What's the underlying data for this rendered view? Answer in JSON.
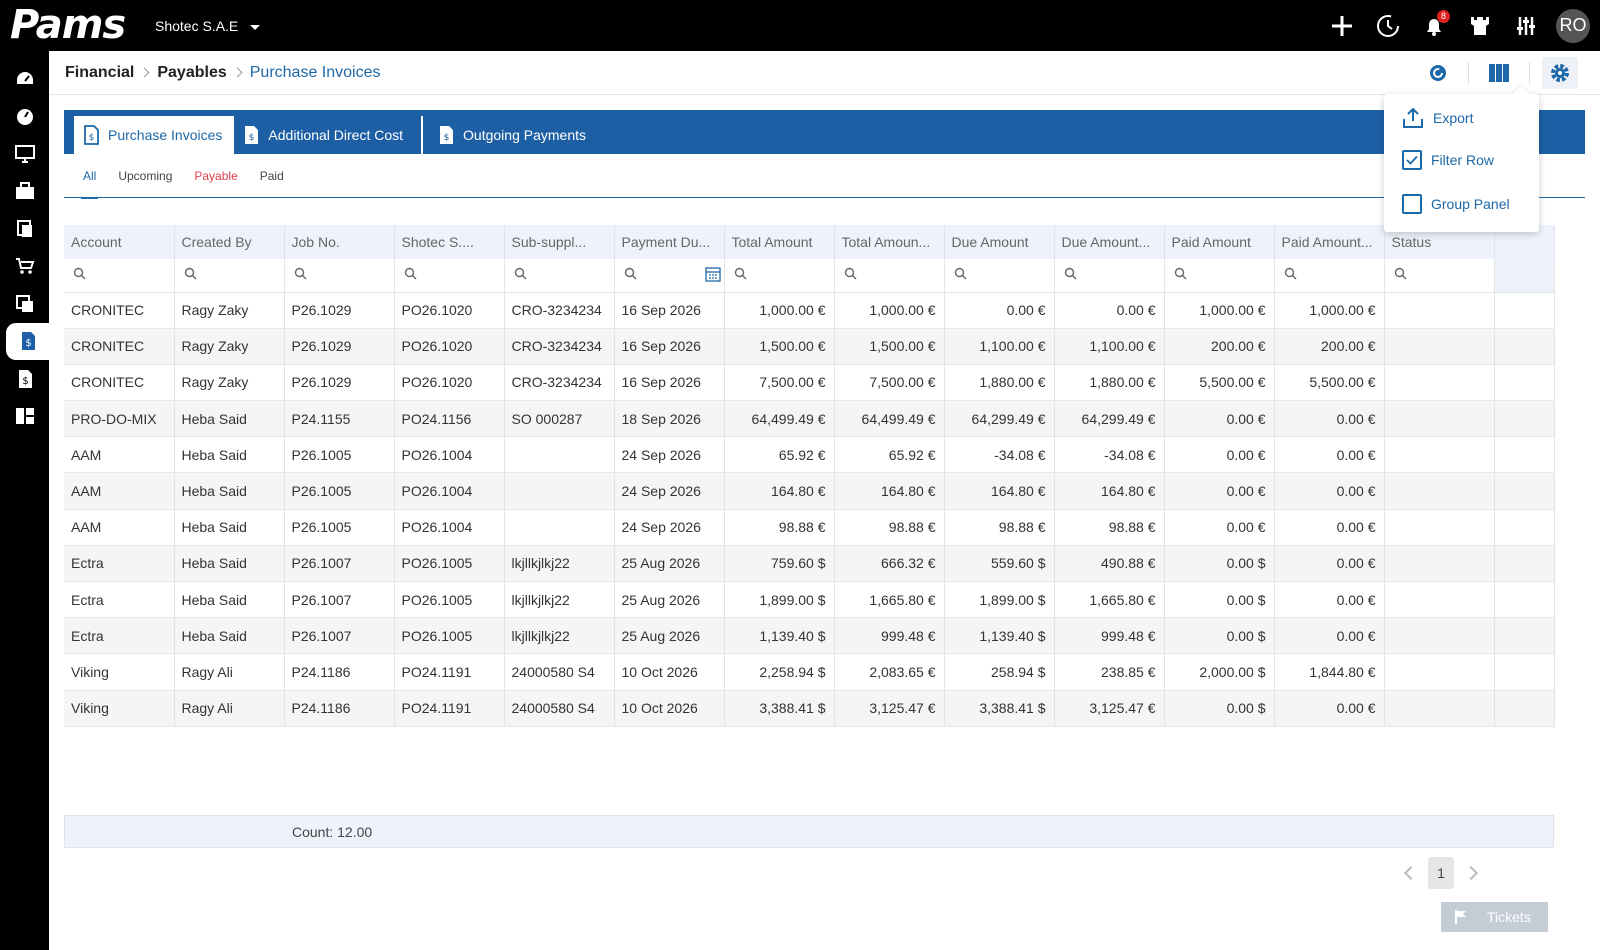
{
  "app": {
    "logo_text": "Pams",
    "company": "Shotec S.A.E",
    "notification_count": "8",
    "avatar_initials": "RO"
  },
  "breadcrumb": {
    "items": [
      "Financial",
      "Payables"
    ],
    "current": "Purchase Invoices"
  },
  "tabs": [
    {
      "label": "Purchase Invoices",
      "icon": "invoice-icon"
    },
    {
      "label": "Additional Direct Cost",
      "icon": "invoice-icon"
    },
    {
      "label": "Outgoing Payments",
      "icon": "invoice-icon"
    }
  ],
  "subtabs": [
    "All",
    "Upcoming",
    "Payable",
    "Paid"
  ],
  "settings_menu": {
    "items": [
      "Export",
      "Filter Row",
      "Group Panel"
    ],
    "filter_row_checked": true,
    "group_panel_checked": false
  },
  "grid": {
    "columns": [
      "Account",
      "Created By",
      "Job No.",
      "Shotec S.A.E Order No.",
      "Sub-supplier Invoice No.",
      "Payment Due Date",
      "Total Amount",
      "Total Amount (EUR)",
      "Due Amount",
      "Due Amount (EUR)",
      "Paid Amount",
      "Paid Amount (EUR)",
      "Status"
    ],
    "columns_display": [
      "Account",
      "Created By",
      "Job No.",
      "Shotec S....",
      "Sub-suppl...",
      "Payment Du...",
      "Total Amount",
      "Total Amoun...",
      "Due Amount",
      "Due Amount...",
      "Paid Amount",
      "Paid Amount...",
      "Status"
    ],
    "rows": [
      [
        "CRONITEC",
        "Ragy Zaky",
        "P26.1029",
        "PO26.1020",
        "CRO-3234234",
        "16 Sep 2026",
        "1,000.00 €",
        "1,000.00 €",
        "0.00 €",
        "0.00 €",
        "1,000.00 €",
        "1,000.00 €",
        ""
      ],
      [
        "CRONITEC",
        "Ragy Zaky",
        "P26.1029",
        "PO26.1020",
        "CRO-3234234",
        "16 Sep 2026",
        "1,500.00 €",
        "1,500.00 €",
        "1,100.00 €",
        "1,100.00 €",
        "200.00 €",
        "200.00 €",
        ""
      ],
      [
        "CRONITEC",
        "Ragy Zaky",
        "P26.1029",
        "PO26.1020",
        "CRO-3234234",
        "16 Sep 2026",
        "7,500.00 €",
        "7,500.00 €",
        "1,880.00 €",
        "1,880.00 €",
        "5,500.00 €",
        "5,500.00 €",
        ""
      ],
      [
        "PRO-DO-MIX",
        "Heba Said",
        "P24.1155",
        "PO24.1156",
        "SO 000287",
        "18 Sep 2026",
        "64,499.49 €",
        "64,499.49 €",
        "64,299.49 €",
        "64,299.49 €",
        "0.00 €",
        "0.00 €",
        ""
      ],
      [
        "AAM",
        "Heba Said",
        "P26.1005",
        "PO26.1004",
        "",
        "24 Sep 2026",
        "65.92 €",
        "65.92 €",
        "-34.08 €",
        "-34.08 €",
        "0.00 €",
        "0.00 €",
        ""
      ],
      [
        "AAM",
        "Heba Said",
        "P26.1005",
        "PO26.1004",
        "",
        "24 Sep 2026",
        "164.80 €",
        "164.80 €",
        "164.80 €",
        "164.80 €",
        "0.00 €",
        "0.00 €",
        ""
      ],
      [
        "AAM",
        "Heba Said",
        "P26.1005",
        "PO26.1004",
        "",
        "24 Sep 2026",
        "98.88 €",
        "98.88 €",
        "98.88 €",
        "98.88 €",
        "0.00 €",
        "0.00 €",
        ""
      ],
      [
        "Ectra",
        "Heba Said",
        "P26.1007",
        "PO26.1005",
        "lkjllkjlkj22",
        "25 Aug 2026",
        "759.60 $",
        "666.32 €",
        "559.60 $",
        "490.88 €",
        "0.00 $",
        "0.00 €",
        ""
      ],
      [
        "Ectra",
        "Heba Said",
        "P26.1007",
        "PO26.1005",
        "lkjllkjlkj22",
        "25 Aug 2026",
        "1,899.00 $",
        "1,665.80 €",
        "1,899.00 $",
        "1,665.80 €",
        "0.00 $",
        "0.00 €",
        ""
      ],
      [
        "Ectra",
        "Heba Said",
        "P26.1007",
        "PO26.1005",
        "lkjllkjlkj22",
        "25 Aug 2026",
        "1,139.40 $",
        "999.48 €",
        "1,139.40 $",
        "999.48 €",
        "0.00 $",
        "0.00 €",
        ""
      ],
      [
        "Viking",
        "Ragy Ali",
        "P24.1186",
        "PO24.1191",
        "24000580 S4",
        "10 Oct 2026",
        "2,258.94 $",
        "2,083.65 €",
        "258.94 $",
        "238.85 €",
        "2,000.00 $",
        "1,844.80 €",
        ""
      ],
      [
        "Viking",
        "Ragy Ali",
        "P24.1186",
        "PO24.1191",
        "24000580 S4",
        "10 Oct 2026",
        "3,388.41 $",
        "3,125.47 €",
        "3,388.41 $",
        "3,125.47 €",
        "0.00 $",
        "0.00 €",
        ""
      ]
    ],
    "footer_count": "Count: 12.00"
  },
  "pager": {
    "current_page": "1"
  },
  "tickets_label": "Tickets",
  "colors": {
    "primary": "#1d5fa5",
    "payable": "#e0404a",
    "topbar": "#000000"
  }
}
